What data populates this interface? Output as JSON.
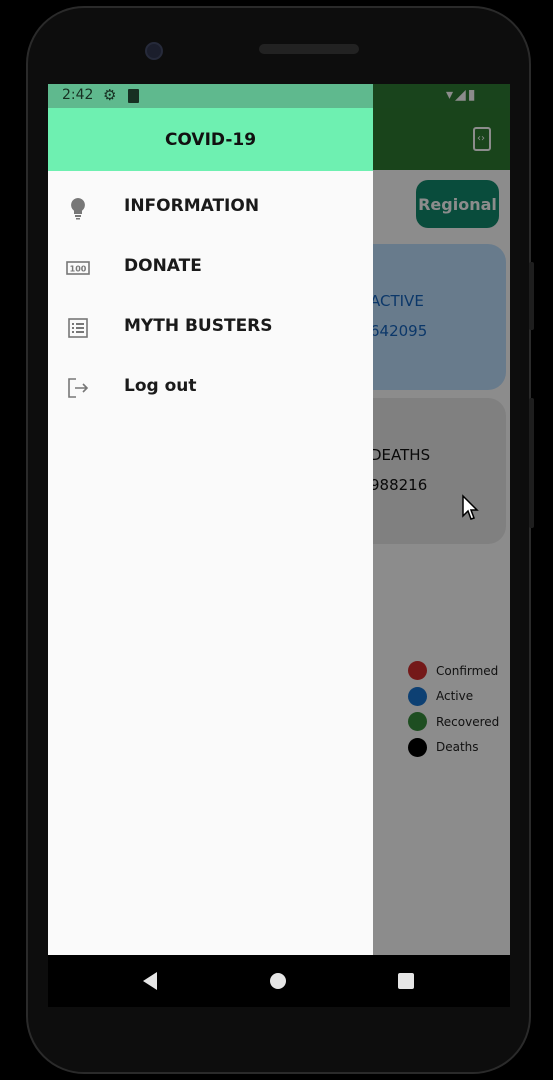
{
  "status_bar": {
    "time": "2:42",
    "right_icons": "▾◢▮"
  },
  "drawer": {
    "title": "COVID-19",
    "items": [
      {
        "label": "INFORMATION",
        "icon": "lightbulb-icon"
      },
      {
        "label": "DONATE",
        "icon": "money-icon"
      },
      {
        "label": "MYTH BUSTERS",
        "icon": "list-icon"
      },
      {
        "label": "Log out",
        "icon": "logout-icon"
      }
    ]
  },
  "background": {
    "regional_label": "Regional",
    "active_card": {
      "label": "ACTIVE",
      "value": "642095"
    },
    "deaths_card": {
      "label": "DEATHS",
      "value": "988216"
    },
    "legend": [
      {
        "label": "Confirmed",
        "color": "#d32f2f"
      },
      {
        "label": "Active",
        "color": "#1976d2"
      },
      {
        "label": "Recovered",
        "color": "#388e3c"
      },
      {
        "label": "Deaths",
        "color": "#000000"
      }
    ]
  }
}
